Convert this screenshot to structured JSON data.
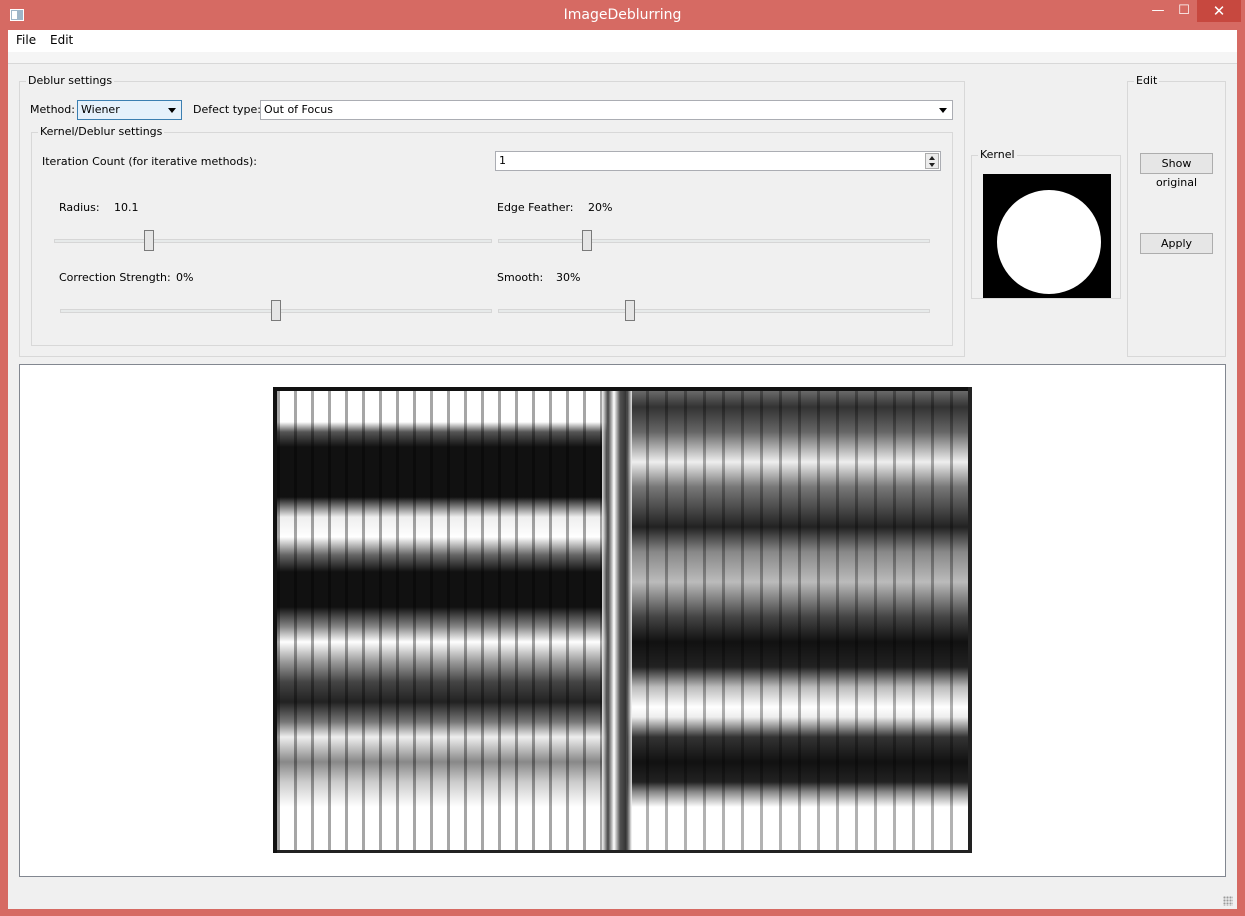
{
  "window": {
    "title": "ImageDeblurring",
    "minimize": "—",
    "maximize": "☐",
    "close": "✕"
  },
  "menu": {
    "file": "File",
    "edit": "Edit"
  },
  "deblur_settings": {
    "title": "Deblur settings",
    "method_label": "Method:",
    "method_value": "Wiener",
    "defect_label": "Defect type:",
    "defect_value": "Out of Focus",
    "kernel_settings": {
      "title": "Kernel/Deblur settings",
      "iteration_label": "Iteration Count (for iterative methods):",
      "iteration_value": "1",
      "radius_label": "Radius:",
      "radius_value": "10.1",
      "edge_feather_label": "Edge Feather:",
      "edge_feather_value": "20%",
      "correction_label": "Correction Strength:",
      "correction_value": "0%",
      "smooth_label": "Smooth:",
      "smooth_value": "30%",
      "slider_levels": {
        "radius": 0.21,
        "edge_feather": 0.2,
        "correction": 0.5,
        "smooth": 0.3
      }
    }
  },
  "kernel": {
    "title": "Kernel"
  },
  "edit": {
    "title": "Edit",
    "show_original": "Show original",
    "apply": "Apply"
  }
}
